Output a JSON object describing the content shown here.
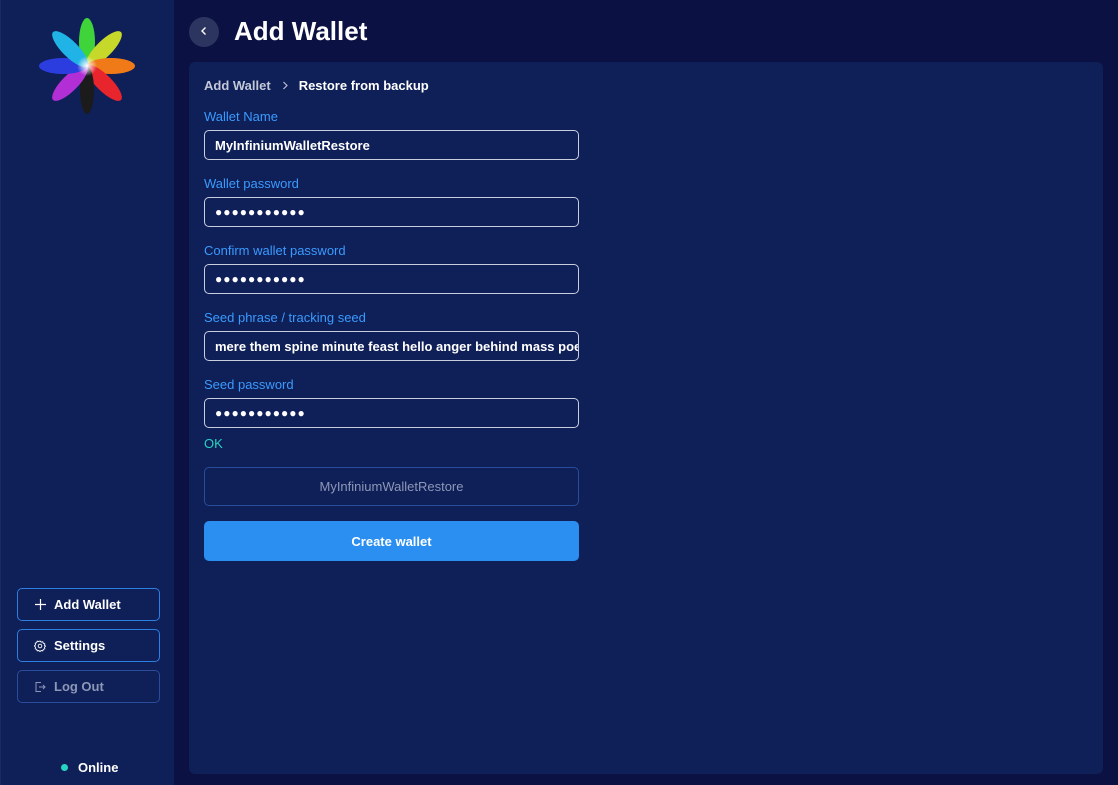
{
  "header": {
    "title": "Add Wallet",
    "back_icon": "chevron-left-icon"
  },
  "breadcrumb": {
    "items": [
      "Add Wallet",
      "Restore from backup"
    ]
  },
  "form": {
    "wallet_name": {
      "label": "Wallet Name",
      "value": "MyInfiniumWalletRestore"
    },
    "wallet_password": {
      "label": "Wallet password",
      "value": "●●●●●●●●●●●"
    },
    "confirm_password": {
      "label": "Confirm wallet password",
      "value": "●●●●●●●●●●●"
    },
    "seed_phrase": {
      "label": "Seed phrase / tracking seed",
      "value": "mere them spine minute feast hello anger behind mass poetry..."
    },
    "seed_password": {
      "label": "Seed password",
      "value": "●●●●●●●●●●●"
    },
    "status_text": "OK",
    "name_display": "MyInfiniumWalletRestore",
    "create_label": "Create wallet"
  },
  "sidebar": {
    "add_wallet": {
      "label": "Add Wallet",
      "icon": "plus-icon"
    },
    "settings": {
      "label": "Settings",
      "icon": "gear-icon"
    },
    "logout": {
      "label": "Log Out",
      "icon": "logout-icon"
    },
    "status": "Online"
  },
  "colors": {
    "background": "#0b1142",
    "panel": "#0f1f57",
    "accent": "#2a8ff0",
    "label": "#3a9bff",
    "online": "#27d4c2"
  }
}
